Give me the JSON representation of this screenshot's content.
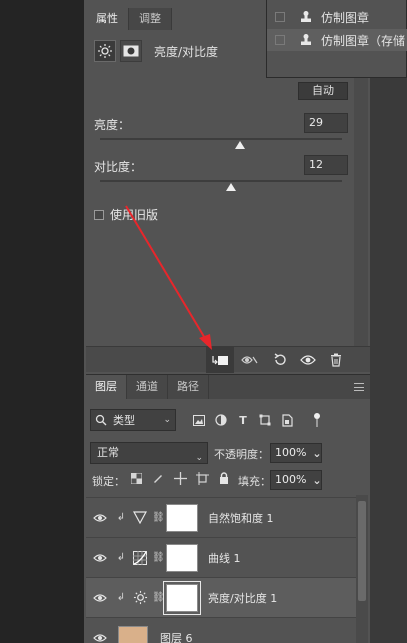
{
  "history_popup": {
    "items": [
      {
        "label": "仿制图章",
        "selected": false
      },
      {
        "label": "仿制图章（存储",
        "selected": true
      }
    ]
  },
  "properties": {
    "tabs": [
      {
        "label": "属性",
        "active": true
      },
      {
        "label": "调整",
        "active": false
      }
    ],
    "panel_title": "亮度/对比度",
    "auto_button": "自动",
    "brightness": {
      "label": "亮度：",
      "value": "29",
      "level": 0.58
    },
    "contrast": {
      "label": "对比度：",
      "value": "12",
      "level": 0.54
    },
    "legacy": {
      "label": "使用旧版",
      "checked": false
    }
  },
  "layers": {
    "tabs": [
      {
        "label": "图层",
        "active": true
      },
      {
        "label": "通道",
        "active": false
      },
      {
        "label": "路径",
        "active": false
      }
    ],
    "filter": {
      "label": "类型"
    },
    "blend_mode": "正常",
    "opacity_label": "不透明度：",
    "opacity_value": "100%",
    "lock_label": "锁定：",
    "fill_label": "填充：",
    "fill_value": "100%",
    "rows": [
      {
        "name": "自然饱和度 1",
        "icon": "vibrance-icon",
        "selected": false
      },
      {
        "name": "曲线 1",
        "icon": "curves-icon",
        "selected": false
      },
      {
        "name": "亮度/对比度 1",
        "icon": "brightness-icon",
        "selected": true
      },
      {
        "name": "图层 6",
        "icon": "image-thumb",
        "selected": false
      }
    ]
  },
  "colors": {
    "annotation_arrow": "#e8262b",
    "panel_bg": "#535353"
  }
}
